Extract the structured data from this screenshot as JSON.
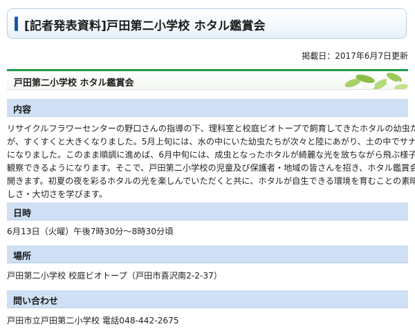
{
  "page_title": "[記者発表資料]戸田第二小学校 ホタル鑑賞会",
  "posted_date": "掲載日：2017年6月7日更新",
  "article_title": "戸田第二小学校 ホタル鑑賞会",
  "sections": {
    "naiyou": {
      "heading": "内容",
      "lines": [
        "リサイクルフラワーセンターの野口さんの指導の下、理科室と校庭ビオトープで飼育してきたホタルの幼虫たち",
        "が、すくすくと大きくなりました。5月上旬には、水の中にいた幼虫たちが次々と陸にあがり、土の中でサナギ",
        "になりました。このまま順調に進めば、6月中旬には、成虫となったホタルが綺麗な光を放ちながら飛ぶ様子を",
        "観察できるようになります。そこで、戸田第二小学校の児童及び保護者・地域の皆さんを招き、ホタル鑑賞会を",
        "開きます。初夏の夜を彩るホタルの光を楽しんでいただくと共に、ホタルが自生できる環境を育むことの素晴ら",
        "しさ・大切さを学びます。"
      ]
    },
    "nichiji": {
      "heading": "日時",
      "text": "6月13日（火曜）午後7時30分～8時30分頃"
    },
    "basho": {
      "heading": "場所",
      "text": "戸田第二小学校 校庭ビオトープ（戸田市喜沢南2-2-37）"
    },
    "toiawase": {
      "heading": "問い合わせ",
      "text": "戸田市立戸田第二小学校 電話048-442-2675"
    }
  },
  "colors": {
    "accent_bar": "#1d53a8",
    "section_header_bg": "#cfe0f4",
    "green_rule": "#1c9a46"
  }
}
